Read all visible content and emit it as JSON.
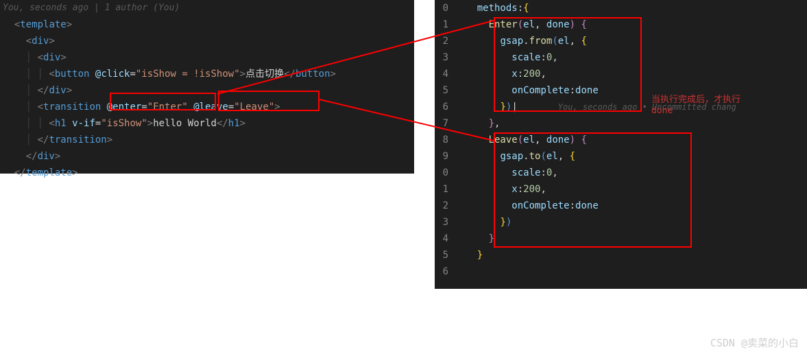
{
  "left": {
    "git_blame_top": "You, seconds ago | 1 author (You)",
    "lines": {
      "l1": "template",
      "l2": "div",
      "l3": "div",
      "l4_tag": "button",
      "l4_attr": "@click",
      "l4_val": "isShow = !isShow",
      "l4_text": "点击切换",
      "l5": "div",
      "l6_tag": "transition",
      "l6_a1": "@enter",
      "l6_v1": "Enter",
      "l6_a2": "@leave",
      "l6_v2": "Leave",
      "l7_tag": "h1",
      "l7_attr": "v-if",
      "l7_val": "isShow",
      "l7_text": "hello World",
      "l8": "transition",
      "l9": "div",
      "l10": "template"
    }
  },
  "right": {
    "ln": {
      "r0": "0",
      "r1": "1",
      "r2": "2",
      "r3": "3",
      "r4": "4",
      "r5": "5",
      "r6": "6",
      "r7": "7",
      "r8": "8",
      "r9": "9",
      "r10": "0",
      "r11": "1",
      "r12": "2",
      "r13": "3",
      "r14": "4",
      "r15": "5",
      "r16": "6"
    },
    "code": {
      "methods": "methods",
      "enter_fn": "Enter",
      "leave_fn": "Leave",
      "p_el": "el",
      "p_done": "done",
      "gsap": "gsap",
      "from": "from",
      "to": "to",
      "scale": "scale",
      "scale_v": "0",
      "x": "x",
      "x_v": "200",
      "onComplete": "onComplete",
      "done": "done"
    },
    "inline_blame": "You, seconds ago • Uncommitted chang"
  },
  "annotation": {
    "line1": "当执行完成后，才执行",
    "line2": "done"
  },
  "watermark": "CSDN @卖菜的小白"
}
